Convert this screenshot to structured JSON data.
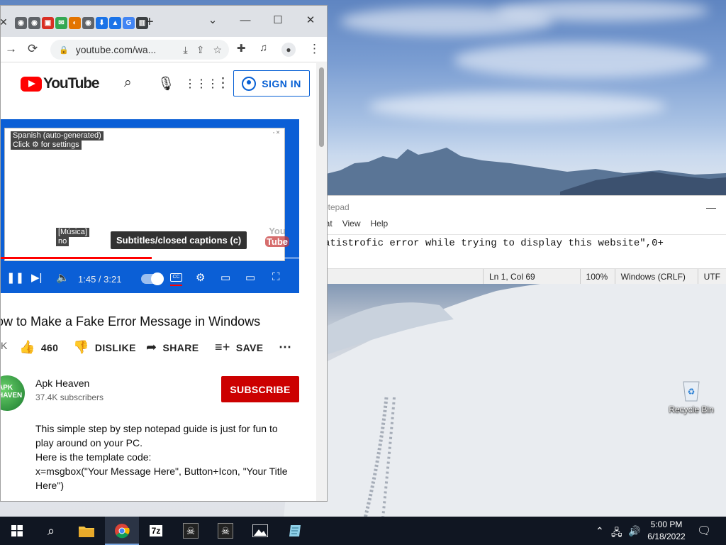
{
  "browser": {
    "address": "youtube.com/wa...",
    "tab_glyphs": [
      "◉",
      "◉",
      "▣",
      "✉",
      "◐",
      "◉",
      "⬇",
      "▲",
      "G",
      "▥"
    ],
    "tab_colors": [
      "#5f6368",
      "#5f6368",
      "#d93025",
      "#34a853",
      "#e37400",
      "#5f6368",
      "#1a73e8",
      "#1a73e8",
      "#4285f4",
      "#3c4043"
    ]
  },
  "youtube": {
    "logo_text": "YouTube",
    "sign_in": "SIGN IN",
    "captions": {
      "line1": "Spanish (auto-generated)",
      "line2": "Click ⚙ for settings",
      "sub1": "[Música]",
      "sub2": "no"
    },
    "tooltip": "Subtitles/closed captions (c)",
    "watermark": {
      "top": "You",
      "bottom": "Tube"
    },
    "progress_fraction": 0.506,
    "time": "1:45 / 3:21",
    "cc_label": "CC",
    "video_title": "ow to Make a Fake Error Message in Windows",
    "views_partial": "K",
    "likes": "460",
    "dislike": "DISLIKE",
    "share": "SHARE",
    "save": "SAVE",
    "channel": {
      "avatar_text": "APK HAVEN",
      "name": "Apk Heaven",
      "subscribers": "37.4K subscribers",
      "subscribe": "SUBSCRIBE"
    },
    "description": {
      "l1": "This simple step by step notepad guide is just for fun to",
      "l2": "play around on your PC.",
      "l3": "Here is the template code:",
      "l4": "x=msgbox(\"Your Message Here\", Button+Icon, \"Your Title",
      "l5": "Here\")"
    }
  },
  "notepad": {
    "title": "otepad",
    "menu": [
      "nat",
      "View",
      "Help"
    ],
    "text": "atistrofic error while trying to display this website\",0+",
    "status": {
      "position": "Ln 1, Col 69",
      "zoom": "100%",
      "eol": "Windows (CRLF)",
      "encoding": "UTF"
    }
  },
  "desktop": {
    "recycle_bin": "Recycle Bin"
  },
  "taskbar": {
    "time": "5:00 PM",
    "date": "6/18/2022",
    "sevenzip": "7z"
  }
}
